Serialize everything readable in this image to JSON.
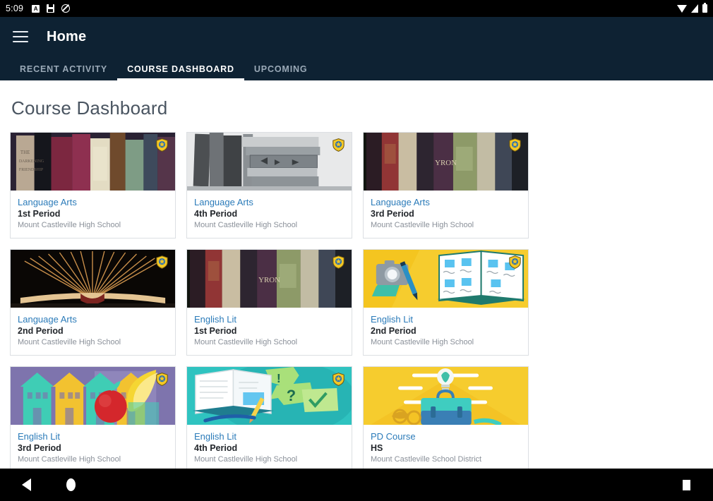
{
  "statusbar": {
    "clock": "5:09",
    "icons_left": [
      "app-notification-icon",
      "save-icon",
      "do-not-disturb-icon"
    ],
    "icons_right": [
      "wifi-icon",
      "cellular-signal-icon",
      "battery-icon"
    ]
  },
  "appbar": {
    "menu_icon": "hamburger-menu-icon",
    "title": "Home",
    "background": "#0e2233",
    "tabs": [
      {
        "label": "RECENT ACTIVITY",
        "active": false
      },
      {
        "label": "COURSE DASHBOARD",
        "active": true
      },
      {
        "label": "UPCOMING",
        "active": false
      }
    ]
  },
  "page": {
    "title": "Course Dashboard",
    "card_title_color": "#2b7bb9",
    "badge_icon": "shield-star-badge-icon",
    "cards": [
      {
        "title": "Language Arts",
        "period": "1st Period",
        "school": "Mount Castleville High School",
        "badge": true,
        "image": "photo-colored-book-spines"
      },
      {
        "title": "Language Arts",
        "period": "4th Period",
        "school": "Mount Castleville High School",
        "badge": true,
        "image": "photo-grayscale-stacked-books"
      },
      {
        "title": "Language Arts",
        "period": "3rd Period",
        "school": "Mount Castleville High School",
        "badge": true,
        "image": "photo-antique-book-spines-dark"
      },
      {
        "title": "Language Arts",
        "period": "2nd Period",
        "school": "Mount Castleville High School",
        "badge": true,
        "image": "photo-open-book-fanned-pages"
      },
      {
        "title": "English Lit",
        "period": "1st Period",
        "school": "Mount Castleville High School",
        "badge": true,
        "image": "photo-antique-book-spines-dark"
      },
      {
        "title": "English Lit",
        "period": "2nd Period",
        "school": "Mount Castleville High School",
        "badge": true,
        "image": "illustration-camera-pen-notebook-yellow"
      },
      {
        "title": "English Lit",
        "period": "3rd Period",
        "school": "Mount Castleville High School",
        "badge": true,
        "image": "illustration-houses-apple-banana-purple"
      },
      {
        "title": "English Lit",
        "period": "4th Period",
        "school": "Mount Castleville High School",
        "badge": true,
        "image": "illustration-notebook-speech-bubbles-teal"
      },
      {
        "title": "PD Course",
        "period": "HS",
        "school": "Mount Castleville School District",
        "badge": false,
        "image": "illustration-lightbulb-briefcase-yellow"
      }
    ]
  },
  "navbar": {
    "back": "back-triangle-icon",
    "home": "home-circle-icon",
    "recent": "recent-apps-square-icon"
  }
}
